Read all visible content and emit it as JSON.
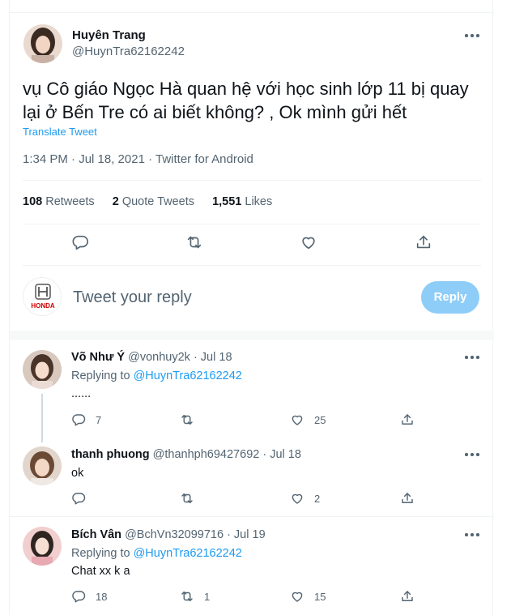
{
  "tweet": {
    "display_name": "Huyên Trang",
    "handle": "@HuynTra62162242",
    "text": "vụ Cô giáo Ngọc Hà quan hệ với học sinh lớp 11  bị quay lại ở Bến Tre có ai biết không? , Ok mình gửi hết",
    "translate_label": "Translate Tweet",
    "meta": "1:34 PM · Jul 18, 2021 · Twitter for Android",
    "retweets_count": "108",
    "retweets_label": "Retweets",
    "quotes_count": "2",
    "quotes_label": "Quote Tweets",
    "likes_count": "1,551",
    "likes_label": "Likes"
  },
  "compose": {
    "avatar_logo_text": "HONDA",
    "placeholder": "Tweet your reply",
    "reply_label": "Reply"
  },
  "replies": [
    {
      "name": "Võ Như Ý",
      "handle": "@vonhuy2k",
      "date": "· Jul 18",
      "replying_label": "Replying to",
      "replying_to": "@HuynTra62162242",
      "text": "......",
      "reply_count": "7",
      "retweet_count": "",
      "like_count": "25"
    },
    {
      "name": "thanh phuong",
      "handle": "@thanhph69427692",
      "date": "· Jul 18",
      "text": "ok",
      "reply_count": "",
      "retweet_count": "",
      "like_count": "2"
    },
    {
      "name": "Bích Vân",
      "handle": "@BchVn32099716",
      "date": "· Jul 19",
      "replying_label": "Replying to",
      "replying_to": "@HuynTra62162242",
      "text": "Chat xx k a",
      "reply_count": "18",
      "retweet_count": "1",
      "like_count": "15"
    }
  ],
  "colors": {
    "accent": "#1d9bf0",
    "reply_button_disabled": "#8ecdf8",
    "secondary_text": "#536471",
    "primary_text": "#0f1419",
    "divider": "#eff3f4"
  },
  "icons": [
    "more-icon",
    "reply-icon",
    "retweet-icon",
    "like-icon",
    "share-icon"
  ]
}
